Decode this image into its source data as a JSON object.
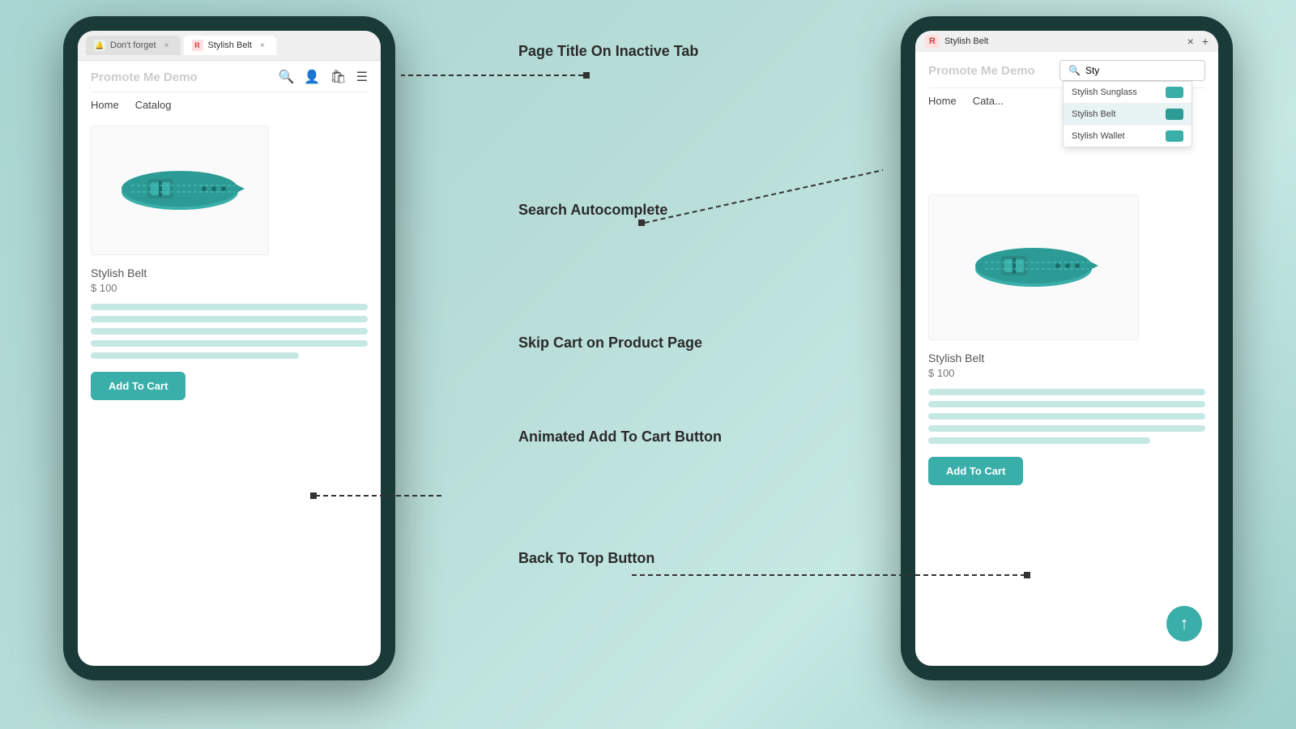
{
  "background": {
    "color_start": "#a8d5d1",
    "color_end": "#9ecfca"
  },
  "annotations": {
    "page_title": "Page Title On\nInactive Tab",
    "search_autocomplete": "Search\nAutocomplete",
    "skip_cart": "Skip Cart on\nProduct Page",
    "animated_add": "Animated Add\nTo Cart Button",
    "back_to_top": "Back To Top\nButton"
  },
  "left_phone": {
    "tabs": [
      {
        "label": "Don't forget",
        "favicon_type": "remind",
        "favicon_text": "🔔",
        "active": false,
        "closeable": true
      },
      {
        "label": "Stylish Belt",
        "favicon_type": "active-fav",
        "favicon_text": "R",
        "active": true,
        "closeable": true
      }
    ],
    "store_name": "Promote Me Demo",
    "nav_items": [
      "Home",
      "Catalog"
    ],
    "product": {
      "name": "Stylish Belt",
      "price": "$ 100",
      "description_lines": 5
    },
    "add_to_cart_label": "Add To Cart"
  },
  "right_phone": {
    "store_name": "Promote Me Demo",
    "search_placeholder": "Sty",
    "nav_items": [
      "Home",
      "Cata..."
    ],
    "autocomplete_items": [
      {
        "label": "Stylish Sunglass",
        "selected": false
      },
      {
        "label": "Stylish Belt",
        "selected": true
      },
      {
        "label": "Stylish Wallet",
        "selected": false
      }
    ],
    "product": {
      "name": "Stylish Belt",
      "price": "$ 100",
      "description_lines": 5
    },
    "add_to_cart_label": "Add To Cart",
    "back_to_top_arrow": "↑"
  }
}
